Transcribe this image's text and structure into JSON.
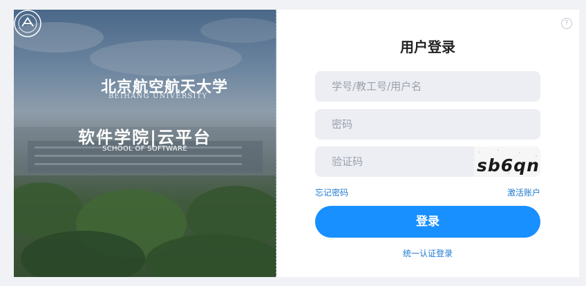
{
  "hero": {
    "university_name": "北京航空航天大学",
    "university_name_en": "BEIHANG UNIVERSITY",
    "school_name": "软件学院|云平台",
    "school_name_en": "SCHOOL OF SOFTWARE"
  },
  "login": {
    "title": "用户登录",
    "username_placeholder": "学号/教工号/用户名",
    "password_placeholder": "密码",
    "captcha_placeholder": "验证码",
    "captcha_text": "sb6qn",
    "forgot_password": "忘记密码",
    "activate_account": "激活账户",
    "login_button": "登录",
    "sso_login": "统一认证登录"
  },
  "help_icon": "question-circle-icon",
  "colors": {
    "primary": "#1890ff",
    "link": "#1f7ad1",
    "input_bg": "#eceef4",
    "page_bg": "#f0f2f5"
  }
}
